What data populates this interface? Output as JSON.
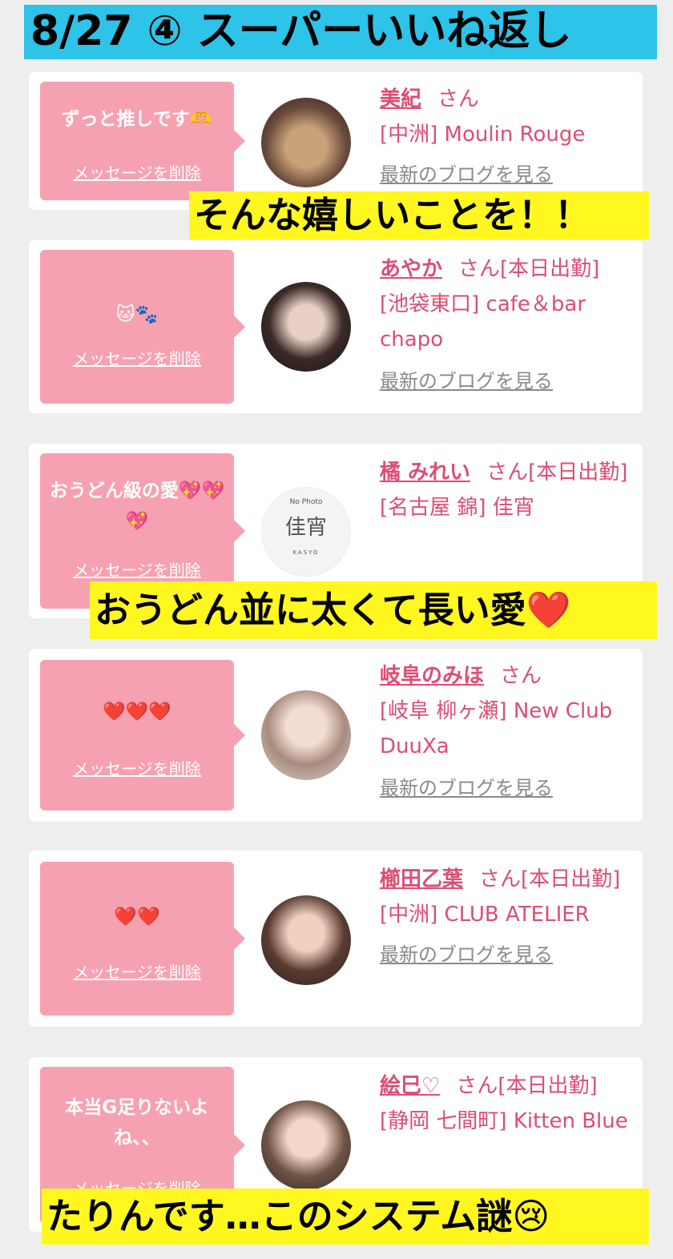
{
  "banner": {
    "title": "8/27 ④ スーパーいいね返し"
  },
  "common": {
    "delete_label": "メッセージを削除",
    "blog_label": "最新のブログを見る",
    "san": "さん"
  },
  "cards": [
    {
      "message": "ずっと推しです🫶",
      "name": "美紀",
      "suffix": "さん",
      "shop": "[中洲] Moulin Rouge"
    },
    {
      "message": "🐱🐾",
      "name": "あやか",
      "suffix": "さん[本日出勤]",
      "shop": "[池袋東口] cafe＆bar chapo"
    },
    {
      "message": "おうどん級の愛💖💖💖",
      "name": "橘 みれい",
      "suffix": "さん[本日出勤]",
      "shop": "[名古屋 錦] 佳宵"
    },
    {
      "message": "❤️❤️❤️",
      "name": "岐阜のみほ",
      "suffix": "さん",
      "shop": "[岐阜 柳ヶ瀬] New Club DuuXa"
    },
    {
      "message": "❤️❤️",
      "name": "櫛田乙葉",
      "suffix": "さん[本日出勤]",
      "shop": "[中洲] CLUB ATELIER"
    },
    {
      "message": "本当G足りないよね、、",
      "name": "絵巳♡",
      "suffix": "さん[本日出勤]",
      "shop": "[静岡 七間町] Kitten Blue"
    }
  ],
  "captions": {
    "c1": "そんな嬉しいことを！！",
    "c2": "おうどん並に太くて長い愛❤️",
    "c3": "たりんです…このシステム謎😢"
  },
  "nophoto": {
    "top": "No Photo",
    "logo": "佳宵",
    "sub": "KASYO"
  },
  "colors": {
    "bubble": "#f6a1b1",
    "link": "#dd4d73",
    "caption_bg": "#fff71f",
    "banner_bg": "#2ec3e8"
  }
}
